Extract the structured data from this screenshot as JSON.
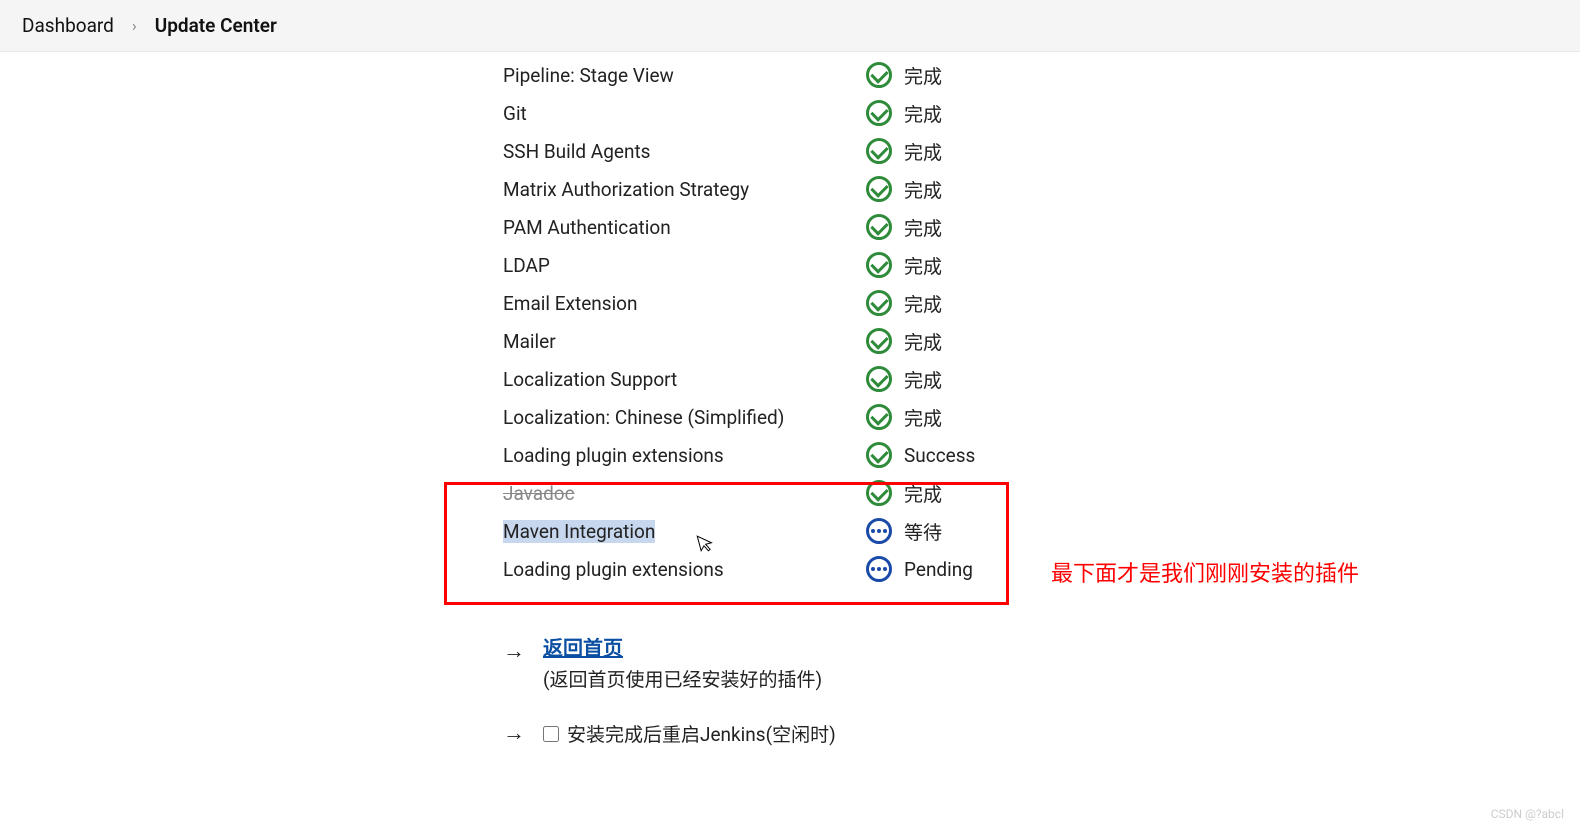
{
  "breadcrumb": {
    "dashboard": "Dashboard",
    "sep": "›",
    "current": "Update Center"
  },
  "plugins": [
    {
      "name": "Pipeline: Stage View",
      "status": "完成",
      "icon": "success"
    },
    {
      "name": "Git",
      "status": "完成",
      "icon": "success"
    },
    {
      "name": "SSH Build Agents",
      "status": "完成",
      "icon": "success"
    },
    {
      "name": "Matrix Authorization Strategy",
      "status": "完成",
      "icon": "success"
    },
    {
      "name": "PAM Authentication",
      "status": "完成",
      "icon": "success"
    },
    {
      "name": "LDAP",
      "status": "完成",
      "icon": "success"
    },
    {
      "name": "Email Extension",
      "status": "完成",
      "icon": "success"
    },
    {
      "name": "Mailer",
      "status": "完成",
      "icon": "success"
    },
    {
      "name": "Localization Support",
      "status": "完成",
      "icon": "success"
    },
    {
      "name": "Localization: Chinese (Simplified)",
      "status": "完成",
      "icon": "success"
    },
    {
      "name": "Loading plugin extensions",
      "status": "Success",
      "icon": "success"
    },
    {
      "name": "Javadoc",
      "status": "完成",
      "icon": "success",
      "strike": true
    },
    {
      "name": "Maven Integration",
      "status": "等待",
      "icon": "pending",
      "selected": true
    },
    {
      "name": "Loading plugin extensions",
      "status": "Pending",
      "icon": "pending"
    }
  ],
  "annotation": "最下面才是我们刚刚安装的插件",
  "footer": {
    "back_link": "返回首页",
    "back_desc": "(返回首页使用已经安装好的插件)",
    "restart_label": "安装完成后重启Jenkins(空闲时)"
  },
  "watermark": "CSDN @?abcl"
}
